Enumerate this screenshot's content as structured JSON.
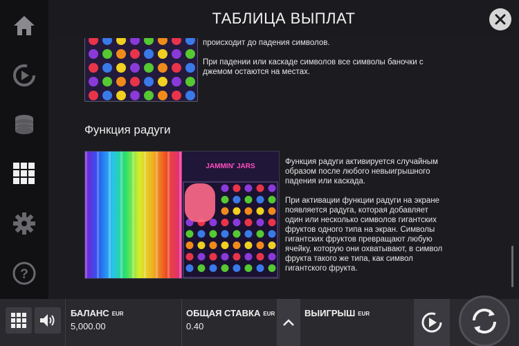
{
  "header": {
    "title": "ТАБЛИЦА ВЫПЛАТ"
  },
  "sidebar": {
    "items": [
      {
        "icon": "home-icon"
      },
      {
        "icon": "autoplay-icon"
      },
      {
        "icon": "coins-icon"
      },
      {
        "icon": "paytable-grid-icon",
        "active": true
      },
      {
        "icon": "settings-icon"
      },
      {
        "icon": "help-icon"
      }
    ]
  },
  "content": {
    "jam_text_line1": "происходит до падения символов.",
    "jam_text_para2": "При падении или каскаде символов все символы баночки с джемом остаются на местах.",
    "section_title": "Функция радуги",
    "rainbow_para1": "Функция радуги активируется случайным образом после любого невыигрышного падения или каскада.",
    "rainbow_para2": "При активации функции радуги на экране появляется радуга, которая добавляет один или несколько символов гигантских фруктов одного типа на экран. Символы гигантских фруктов превращают любую ячейку, которую они охватывают, в символ фрукта такого же типа, как символ гигантского фрукта.",
    "game_logo": "JAMMIN' JARS"
  },
  "bottombar": {
    "balance_label": "БАЛАНС",
    "balance_unit": "EUR",
    "balance_value": "5,000.00",
    "bet_label": "ОБЩАЯ СТАВКА",
    "bet_unit": "EUR",
    "bet_value": "0.40",
    "win_label": "ВЫИГРЫШ",
    "win_unit": "EUR"
  },
  "colors": {
    "background": "#1c1c20",
    "bar": "#2a2a2e",
    "text": "#e6e6e6"
  }
}
